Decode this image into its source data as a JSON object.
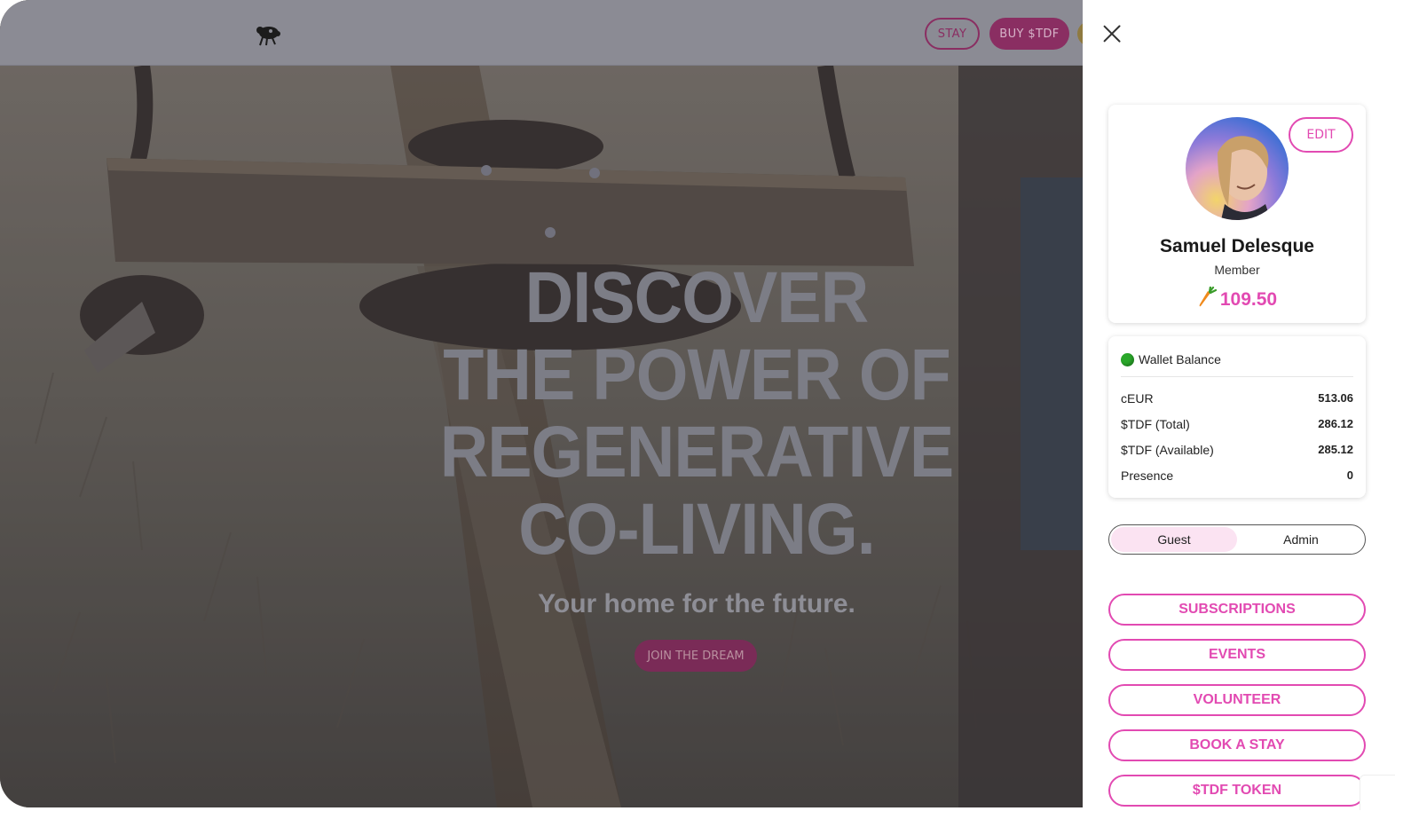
{
  "header": {
    "stay_label": "STAY",
    "buy_label": "BUY $TDF"
  },
  "hero": {
    "lines": [
      "DISCOVER",
      "THE POWER OF",
      "REGENERATIVE",
      "CO-LIVING."
    ],
    "subtitle": "Your home for the future.",
    "cta_label": "JOIN THE DREAM"
  },
  "profile": {
    "edit_label": "EDIT",
    "name": "Samuel Delesque",
    "role": "Member",
    "balance": "109.50"
  },
  "wallet": {
    "title": "Wallet Balance",
    "rows": [
      {
        "label": "cEUR",
        "value": "513.06"
      },
      {
        "label": "$TDF (Total)",
        "value": "286.12"
      },
      {
        "label": "$TDF (Available)",
        "value": "285.12"
      },
      {
        "label": "Presence",
        "value": "0"
      }
    ]
  },
  "mode_toggle": {
    "options": [
      "Guest",
      "Admin"
    ],
    "selected": "Guest"
  },
  "menu": [
    "SUBSCRIPTIONS",
    "EVENTS",
    "VOLUNTEER",
    "BOOK A STAY",
    "$TDF TOKEN"
  ],
  "colors": {
    "accent": "#e24ab2",
    "header_button": "#8a2e62",
    "wallet_dot": "#2aa82a"
  },
  "icons": {
    "logo": "sheep-logo-icon",
    "close": "close-icon",
    "balance": "carrot-icon",
    "wallet_status": "green-dot-icon"
  }
}
